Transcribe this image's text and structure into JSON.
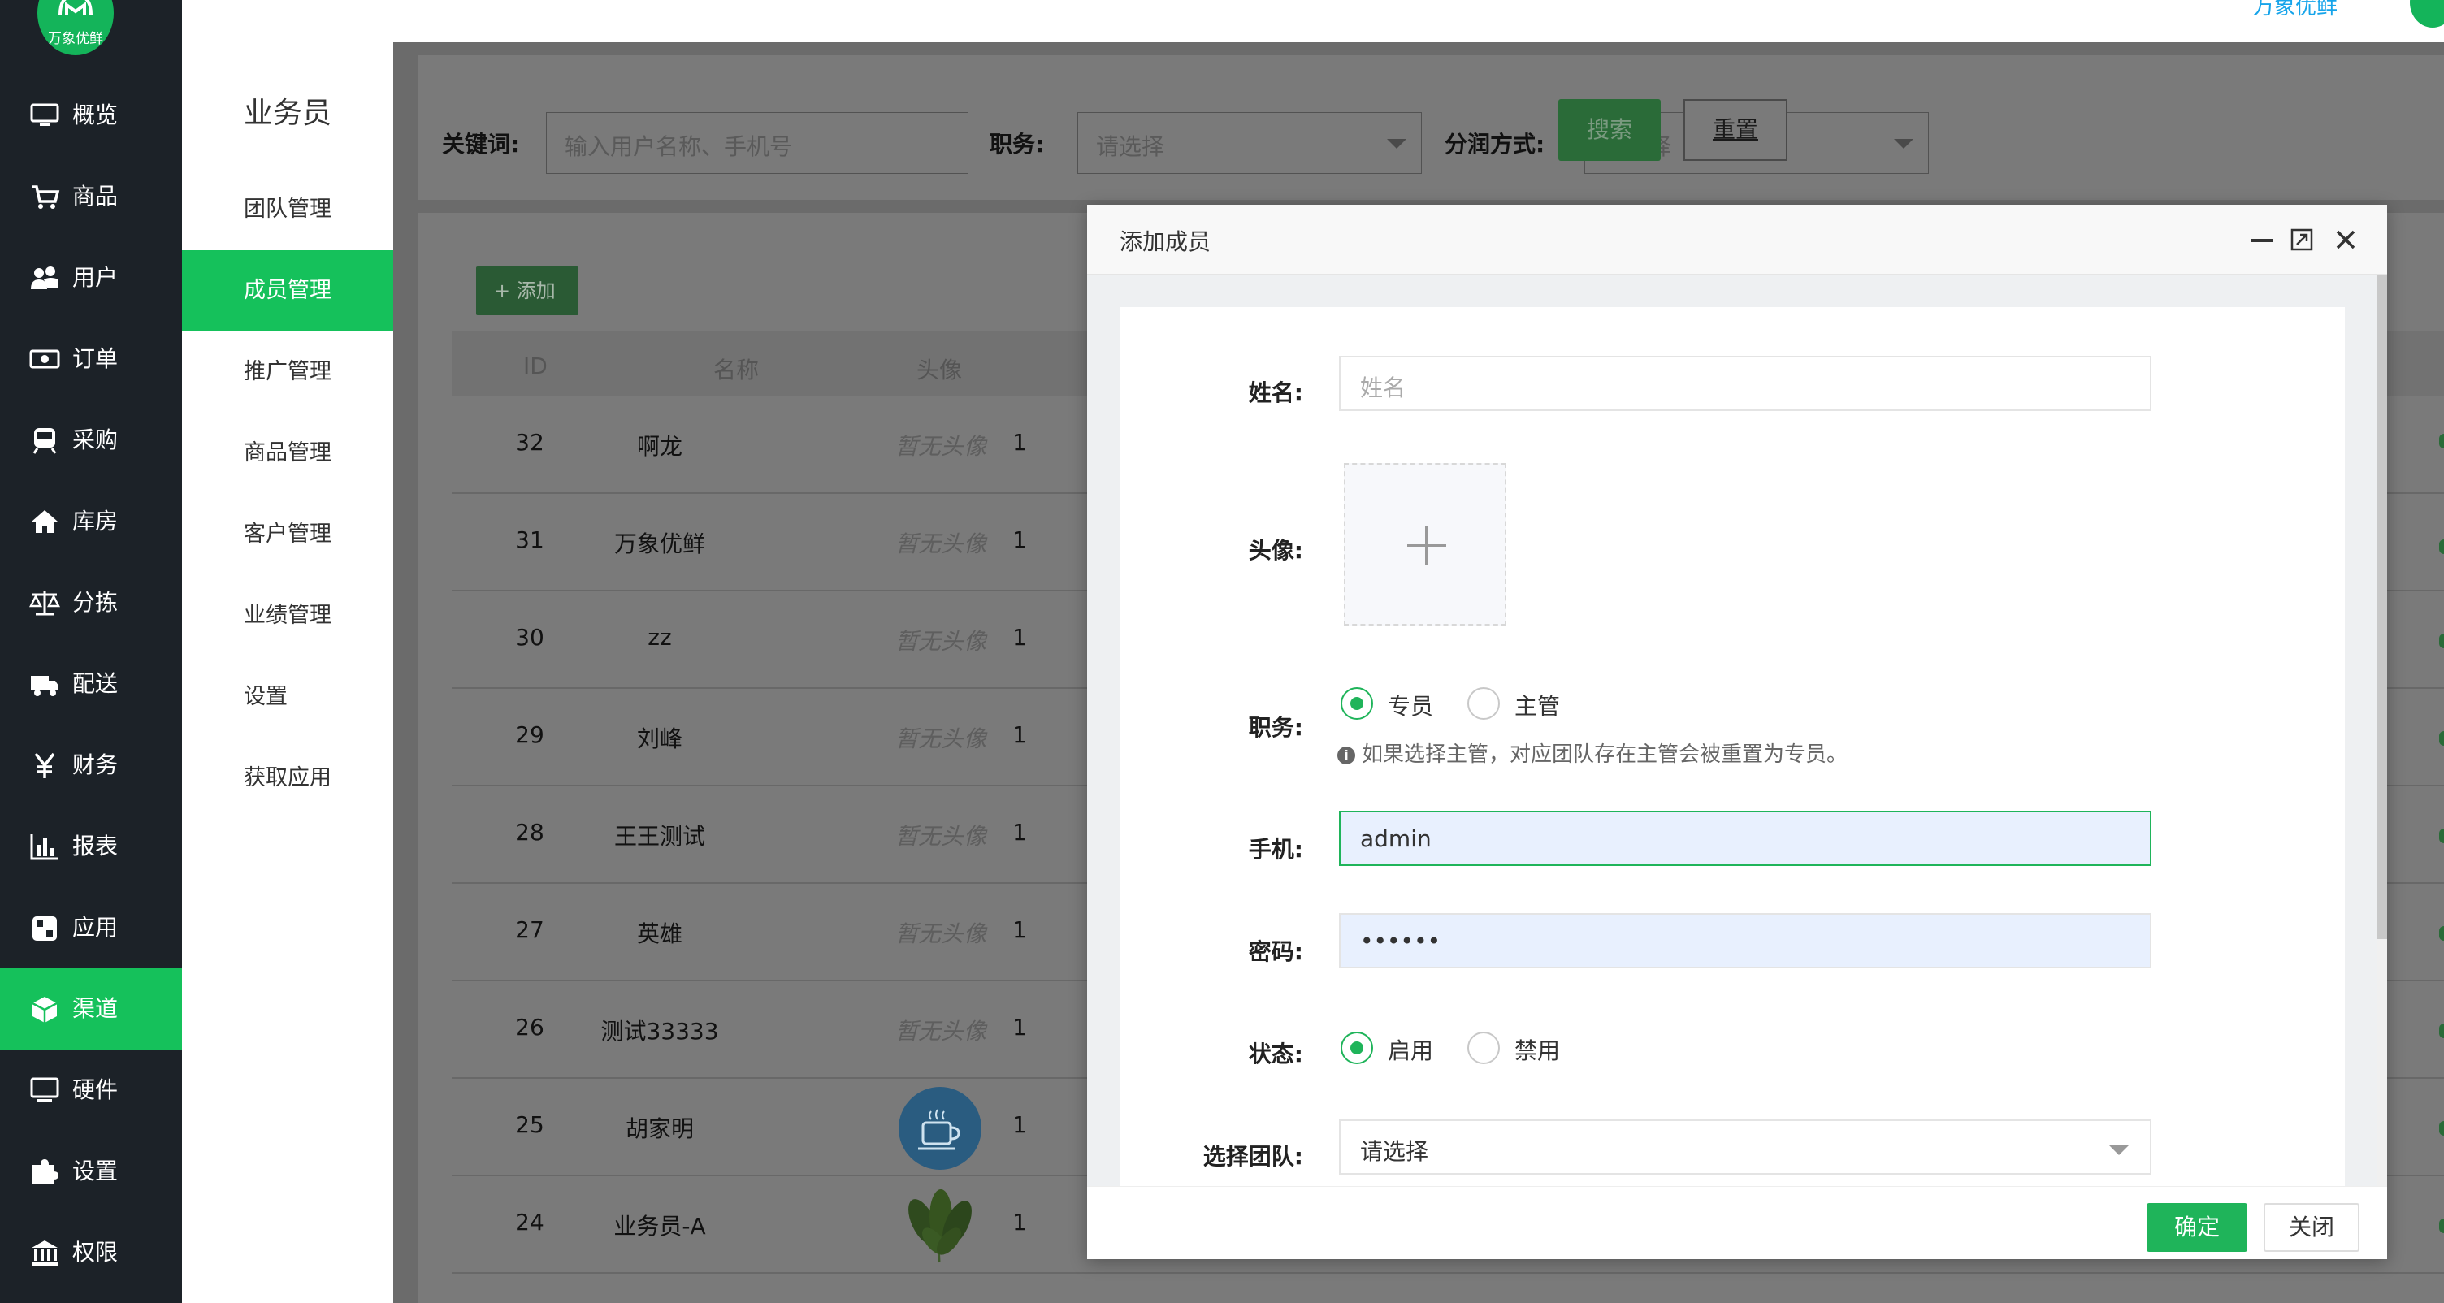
{
  "logo": {
    "text": "万象优鲜"
  },
  "header": {
    "brand_link": "万象优鲜"
  },
  "nav": {
    "items": [
      {
        "label": "概览",
        "icon": "monitor-icon",
        "active": false
      },
      {
        "label": "商品",
        "icon": "cart-icon",
        "active": false
      },
      {
        "label": "用户",
        "icon": "users-icon",
        "active": false
      },
      {
        "label": "订单",
        "icon": "money-icon",
        "active": false
      },
      {
        "label": "采购",
        "icon": "train-icon",
        "active": false
      },
      {
        "label": "库房",
        "icon": "home-icon",
        "active": false
      },
      {
        "label": "分拣",
        "icon": "scale-icon",
        "active": false
      },
      {
        "label": "配送",
        "icon": "truck-icon",
        "active": false
      },
      {
        "label": "财务",
        "icon": "yen-icon",
        "active": false
      },
      {
        "label": "报表",
        "icon": "bar-chart-icon",
        "active": false
      },
      {
        "label": "应用",
        "icon": "apps-icon",
        "active": false
      },
      {
        "label": "渠道",
        "icon": "cube-icon",
        "active": true
      },
      {
        "label": "硬件",
        "icon": "desktop-icon",
        "active": false
      },
      {
        "label": "设置",
        "icon": "puzzle-icon",
        "active": false
      },
      {
        "label": "权限",
        "icon": "bank-icon",
        "active": false
      }
    ]
  },
  "submenu": {
    "title": "业务员",
    "items": [
      {
        "label": "团队管理",
        "active": false
      },
      {
        "label": "成员管理",
        "active": true
      },
      {
        "label": "推广管理",
        "active": false
      },
      {
        "label": "商品管理",
        "active": false
      },
      {
        "label": "客户管理",
        "active": false
      },
      {
        "label": "业绩管理",
        "active": false
      },
      {
        "label": "设置",
        "active": false
      },
      {
        "label": "获取应用",
        "active": false
      }
    ]
  },
  "filter": {
    "keyword_label": "关键词:",
    "keyword_placeholder": "输入用户名称、手机号",
    "role_label": "职务:",
    "role_placeholder": "请选择",
    "share_label": "分润方式:",
    "share_placeholder": "请选择",
    "search_label": "搜索",
    "reset_label": "重置"
  },
  "toolbar": {
    "add_label": "+ 添加"
  },
  "table": {
    "headers": [
      "ID",
      "名称",
      "头像"
    ],
    "rows": [
      {
        "id": "32",
        "name": "啊龙",
        "avatar": "暂无头像",
        "more": "1"
      },
      {
        "id": "31",
        "name": "万象优鲜",
        "avatar": "暂无头像",
        "more": "1"
      },
      {
        "id": "30",
        "name": "zz",
        "avatar": "暂无头像",
        "more": "1"
      },
      {
        "id": "29",
        "name": "刘峰",
        "avatar": "暂无头像",
        "more": "1"
      },
      {
        "id": "28",
        "name": "王王测试",
        "avatar": "暂无头像",
        "more": "1"
      },
      {
        "id": "27",
        "name": "英雄",
        "avatar": "暂无头像",
        "more": "1"
      },
      {
        "id": "26",
        "name": "测试33333",
        "avatar": "暂无头像",
        "more": "1"
      },
      {
        "id": "25",
        "name": "胡家明",
        "avatar": "coffee-cup-image",
        "more": "1"
      },
      {
        "id": "24",
        "name": "业务员-A",
        "avatar": "vegetable-image",
        "more": "1"
      }
    ]
  },
  "dialog": {
    "title": "添加成员",
    "name_label": "姓名:",
    "name_placeholder": "姓名",
    "avatar_label": "头像:",
    "role_label": "职务:",
    "role_options": [
      "专员",
      "主管"
    ],
    "role_selected": "专员",
    "role_hint": "如果选择主管，对应团队存在主管会被重置为专员。",
    "phone_label": "手机:",
    "phone_value": "admin",
    "password_label": "密码:",
    "password_value": "••••••",
    "status_label": "状态:",
    "status_options": [
      "启用",
      "禁用"
    ],
    "status_selected": "启用",
    "team_label": "选择团队:",
    "team_value": "请选择",
    "ok_label": "确定",
    "close_label": "关闭"
  },
  "colors": {
    "accent": "#15c15b",
    "sidebar": "#1c2228",
    "link": "#16a4ea"
  }
}
